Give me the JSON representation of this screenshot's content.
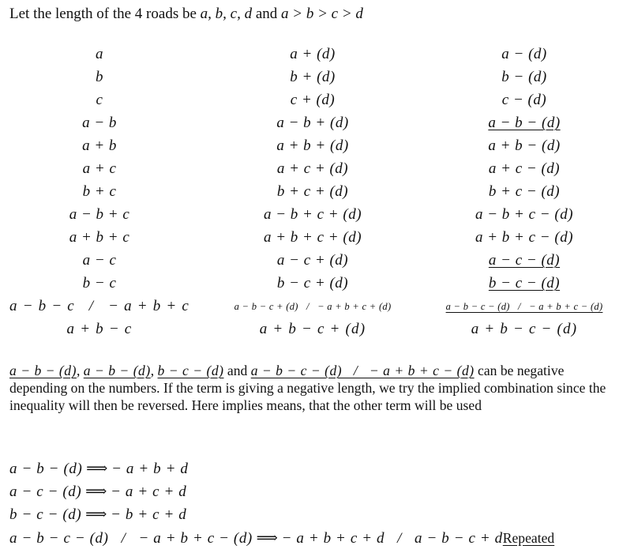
{
  "intro": {
    "text": "Let the length of the 4 roads be ",
    "vars": "a, b, c, d",
    "and": " and ",
    "inequality": "a > b > c > d"
  },
  "table": {
    "rows": [
      {
        "c1": "a",
        "c2": "a + (d)",
        "c3": "a − (d)",
        "c3_underlined": false
      },
      {
        "c1": "b",
        "c2": "b + (d)",
        "c3": "b − (d)",
        "c3_underlined": false
      },
      {
        "c1": "c",
        "c2": "c + (d)",
        "c3": "c − (d)",
        "c3_underlined": false
      },
      {
        "c1": "a − b",
        "c2": "a − b + (d)",
        "c3": "a − b − (d)",
        "c3_underlined": true
      },
      {
        "c1": "a + b",
        "c2": "a + b + (d)",
        "c3": "a + b − (d)",
        "c3_underlined": false
      },
      {
        "c1": "a + c",
        "c2": "a + c + (d)",
        "c3": "a + c − (d)",
        "c3_underlined": false
      },
      {
        "c1": "b + c",
        "c2": "b + c + (d)",
        "c3": "b + c − (d)",
        "c3_underlined": false
      },
      {
        "c1": "a − b + c",
        "c2": "a − b + c + (d)",
        "c3": "a − b + c − (d)",
        "c3_underlined": false
      },
      {
        "c1": "a + b + c",
        "c2": "a + b + c + (d)",
        "c3": "a + b + c − (d)",
        "c3_underlined": false
      },
      {
        "c1": "a − c",
        "c2": "a − c + (d)",
        "c3": "a − c − (d)",
        "c3_underlined": true
      },
      {
        "c1": "b − c",
        "c2": "b − c + (d)",
        "c3": "b − c − (d)",
        "c3_underlined": true
      },
      {
        "c1": "a − b − c   /   − a + b + c",
        "c2": "a − b − c + (d)   /   − a + b + c + (d)",
        "c3": "a − b − c − (d)   /   − a + b + c − (d)",
        "c3_underlined": true
      },
      {
        "c1": "a + b − c",
        "c2": "a + b − c + (d)",
        "c3": "a + b − c − (d)",
        "c3_underlined": false
      }
    ]
  },
  "paragraph": {
    "terms": [
      "a − b − (d)",
      "a − b − (d)",
      "b − c − (d)"
    ],
    "sep": ",",
    "and": " and ",
    "last_term": "a − b − c − (d)   /   − a + b + c − (d)",
    "text": " can be negative depending on the numbers. If the term is giving a negative length, we try the implied combination since the inequality will then be reversed. Here implies means, that the other term will be used"
  },
  "implications": [
    {
      "lhs": "a − b − (d)",
      "arrow": "⟹",
      "rhs": "− a + b + d",
      "note": ""
    },
    {
      "lhs": "a − c − (d)",
      "arrow": "⟹",
      "rhs": "− a + c + d",
      "note": ""
    },
    {
      "lhs": "b − c − (d)",
      "arrow": "⟹",
      "rhs": "− b + c + d",
      "note": ""
    },
    {
      "lhs": "a − b − c − (d)   /   − a + b + c − (d)",
      "arrow": "⟹",
      "rhs": "− a + b + c + d   /   a − b − c + d",
      "note": "Repeated"
    }
  ]
}
